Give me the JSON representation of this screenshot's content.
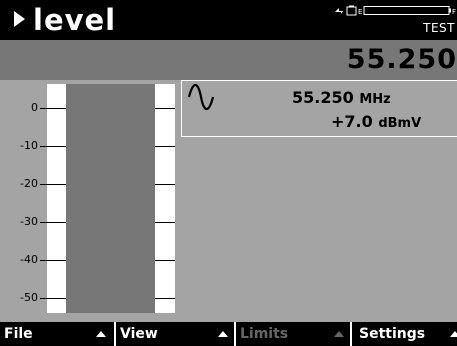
{
  "header": {
    "title": "level",
    "test_label": "TEST"
  },
  "banner": {
    "frequency": "55.250"
  },
  "meter": {
    "scale_labels": [
      "0",
      "-10",
      "-20",
      "-30",
      "-40",
      "-50"
    ]
  },
  "readout": {
    "frequency_value": "55.250",
    "frequency_unit": "MHz",
    "level_value": "+7.0",
    "level_unit": "dBmV",
    "icon": "sine-wave-icon"
  },
  "menu": {
    "file": "File",
    "view": "View",
    "limits": "Limits",
    "settings": "Settings"
  },
  "status_icons": [
    "charging-icon",
    "battery-icon"
  ],
  "colors": {
    "header_bg": "#000000",
    "banner_bg": "#777777",
    "panel_bg": "#a4a4a4",
    "meter_bar": "#777777",
    "disabled_text": "#666666"
  }
}
